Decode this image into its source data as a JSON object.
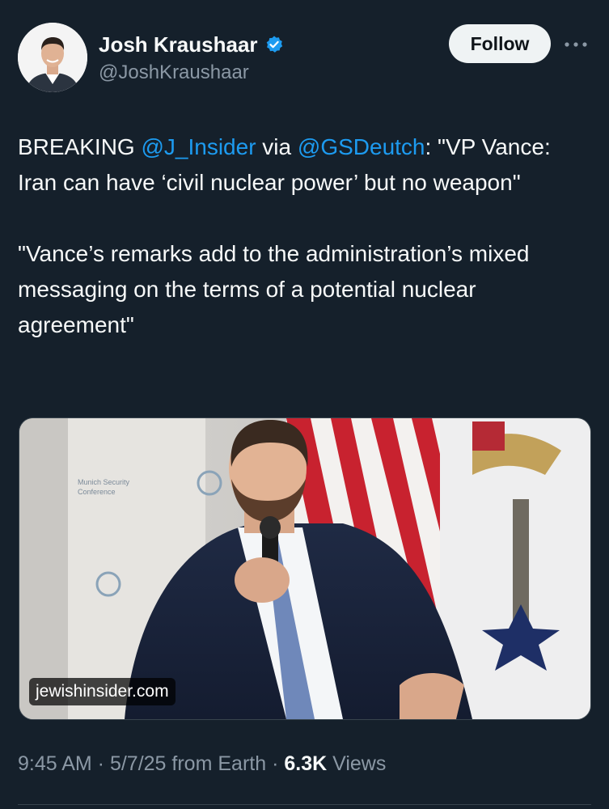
{
  "author": {
    "display_name": "Josh Kraushaar",
    "handle": "@JoshKraushaar",
    "verified": true
  },
  "header_actions": {
    "follow_label": "Follow",
    "more_icon": "more-dots-icon"
  },
  "tweet": {
    "p1": {
      "t1": "BREAKING ",
      "m1": "@J_Insider",
      "t2": " via ",
      "m2": "@GSDeutch",
      "t3": ": \"VP Vance: Iran can have ‘civil nuclear power’ but no weapon\""
    },
    "p2": "\"Vance’s remarks add to the administration’s mixed messaging on the terms of a potential nuclear agreement\""
  },
  "media": {
    "source_label": "jewishinsider.com",
    "backdrop_text_1": "Munich Security",
    "backdrop_text_2": "Conference"
  },
  "meta": {
    "time": "9:45 AM",
    "sep1": " · ",
    "date": "5/7/25",
    "source": " from Earth",
    "sep2": " · ",
    "views_count": "6.3K",
    "views_label": " Views"
  },
  "colors": {
    "background": "#15202b",
    "text": "#f7f9f9",
    "muted": "#8b98a5",
    "link": "#1d9bf0",
    "follow_bg": "#eff3f4"
  }
}
